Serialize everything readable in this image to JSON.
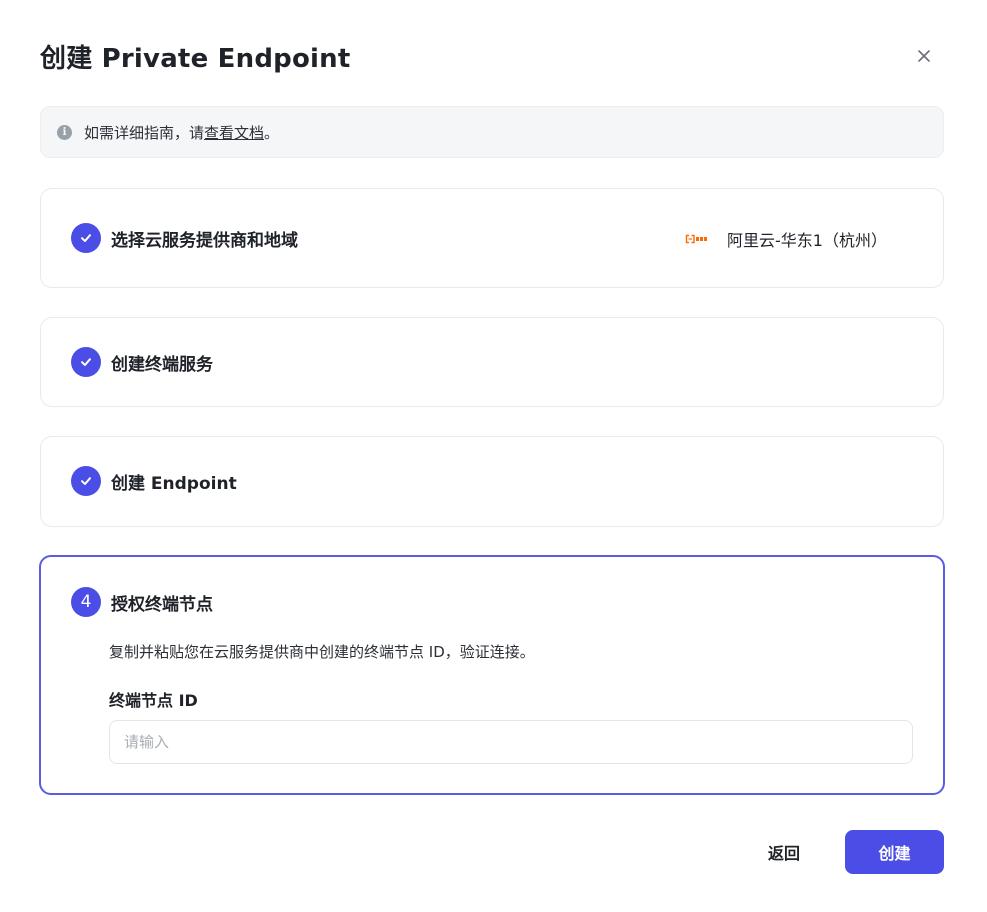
{
  "dialog": {
    "title": "创建 Private Endpoint",
    "close_icon": "close-icon"
  },
  "info": {
    "icon": "info-icon",
    "icon_glyph": "i",
    "text_before": "如需详细指南，请",
    "link_text": "查看文档",
    "text_after": "。"
  },
  "steps": [
    {
      "status": "completed",
      "icon": "check-icon",
      "title": "选择云服务提供商和地域",
      "provider_logo": "aliyun-logo",
      "provider_text": "阿里云-华东1（杭州）"
    },
    {
      "status": "completed",
      "icon": "check-icon",
      "title": "创建终端服务"
    },
    {
      "status": "completed",
      "icon": "check-icon",
      "title": "创建 Endpoint"
    },
    {
      "status": "active",
      "number": "4",
      "title": "授权终端节点",
      "description": "复制并粘贴您在云服务提供商中创建的终端节点 ID，验证连接。",
      "field_label": "终端节点 ID",
      "input_value": "",
      "input_placeholder": "请输入"
    }
  ],
  "footer": {
    "back_label": "返回",
    "create_label": "创建"
  },
  "colors": {
    "primary": "#4a4de6",
    "active_border": "#5b5ce2",
    "banner_bg": "#f5f6f8",
    "aliyun_orange": "#ff6a00"
  }
}
